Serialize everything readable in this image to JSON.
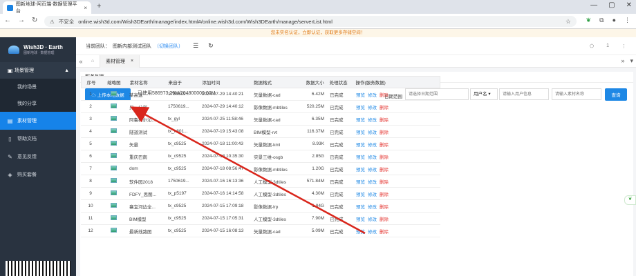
{
  "browser": {
    "tab_title": "图新地球-阿页端-数据管理平台",
    "url": "online.wish3d.com/Wish3DEarth/manage/index.html#/online.wish3d.com/Wish3DEarth/manage/serverList.html",
    "security": "不安全"
  },
  "notice": "您未实名认证，立即认证，获取更多存储空间！",
  "sidebar": {
    "brand": "Wish3D · Earth",
    "brand_sub": "图新地球 · 数据管理",
    "group": "场景管理",
    "items": [
      "我的场景",
      "我的分享"
    ],
    "main": [
      {
        "label": "素材管理",
        "active": true
      },
      {
        "label": "帮助文档"
      },
      {
        "label": "意见反馈"
      },
      {
        "label": "购买套餐"
      }
    ]
  },
  "topbar": {
    "team_label": "当前团队：",
    "team_name": "图新内部测试团队",
    "switch": "（切换团队）",
    "user": "1"
  },
  "tabs": {
    "page_tab": "素材管理"
  },
  "panel": {
    "title": "服务列表",
    "upload": "上传本地数据",
    "usage": "已使用586973.29M/204800000.00M",
    "date_label": "日期范围",
    "date_placeholder": "请选择日期范围",
    "select_value": "用户名",
    "user_placeholder": "请输入用户信息",
    "material_placeholder": "请输入素材名称",
    "query": "查询"
  },
  "table": {
    "columns": [
      "序号",
      "缩略图",
      "素材名称",
      "来自于",
      "添加时间",
      "数据格式",
      "数据大小",
      "处理状态",
      "操作(服务数据)"
    ],
    "actions": [
      "预览",
      "修改",
      "删除"
    ],
    "rows": [
      [
        "1",
        "某高速",
        "1750619...",
        "2024-07-29 14:40:21",
        "矢量数据-cad",
        "6.42M",
        "已完成"
      ],
      [
        "2",
        "另一分部",
        "1750619...",
        "2024-07-29 14:40:12",
        "影像数据-mbtiles",
        "520.25M",
        "已完成"
      ],
      [
        "3",
        "阿鲁科尔沁...",
        "tx_gyl",
        "2024-07-25 11:58:46",
        "矢量数据-cad",
        "6.35M",
        "已完成"
      ],
      [
        "4",
        "隧道测试",
        "tx_h801...",
        "2024-07-19 15:43:08",
        "BIM模型-rvt",
        "116.37M",
        "已完成"
      ],
      [
        "5",
        "矢量",
        "tx_c9525",
        "2024-07-18 11:00:43",
        "矢量数据-kml",
        "8.93K",
        "已完成"
      ],
      [
        "6",
        "重庆巴南",
        "tx_c9525",
        "2024-07-18 10:35:30",
        "实景三维-osgb",
        "2.85G",
        "已完成"
      ],
      [
        "7",
        "dom",
        "tx_c9525",
        "2024-07-18 08:56:47",
        "影像数据-mbtiles",
        "1.20G",
        "已完成"
      ],
      [
        "8",
        "软件园2018",
        "1750619...",
        "2024-07-16 16:13:36",
        "人工模型-3dtiles",
        "571.84M",
        "已完成"
      ],
      [
        "9",
        "FDFY_思图...",
        "tx_p5197",
        "2024-07-16 14:14:58",
        "人工模型-3dtiles",
        "4.30M",
        "已完成"
      ],
      [
        "10",
        "襄宜河边全...",
        "tx_c9525",
        "2024-07-15 17:09:18",
        "影像数据-lrp",
        "1.84G",
        "已完成"
      ],
      [
        "11",
        "BIM模型",
        "tx_c9525",
        "2024-07-15 17:05:31",
        "人工模型-3dtiles",
        "7.90M",
        "已完成"
      ],
      [
        "12",
        "最新线路图",
        "tx_c9525",
        "2024-07-15 16:08:13",
        "矢量数据-cad",
        "5.09M",
        "已完成"
      ]
    ]
  },
  "colors": {
    "accent": "#1e88e5",
    "arrow": "#d9261c",
    "sidebar": "#293340"
  },
  "annotation": {
    "type": "red-arrow",
    "from_row": "6",
    "to_label": "上传本地数据"
  }
}
